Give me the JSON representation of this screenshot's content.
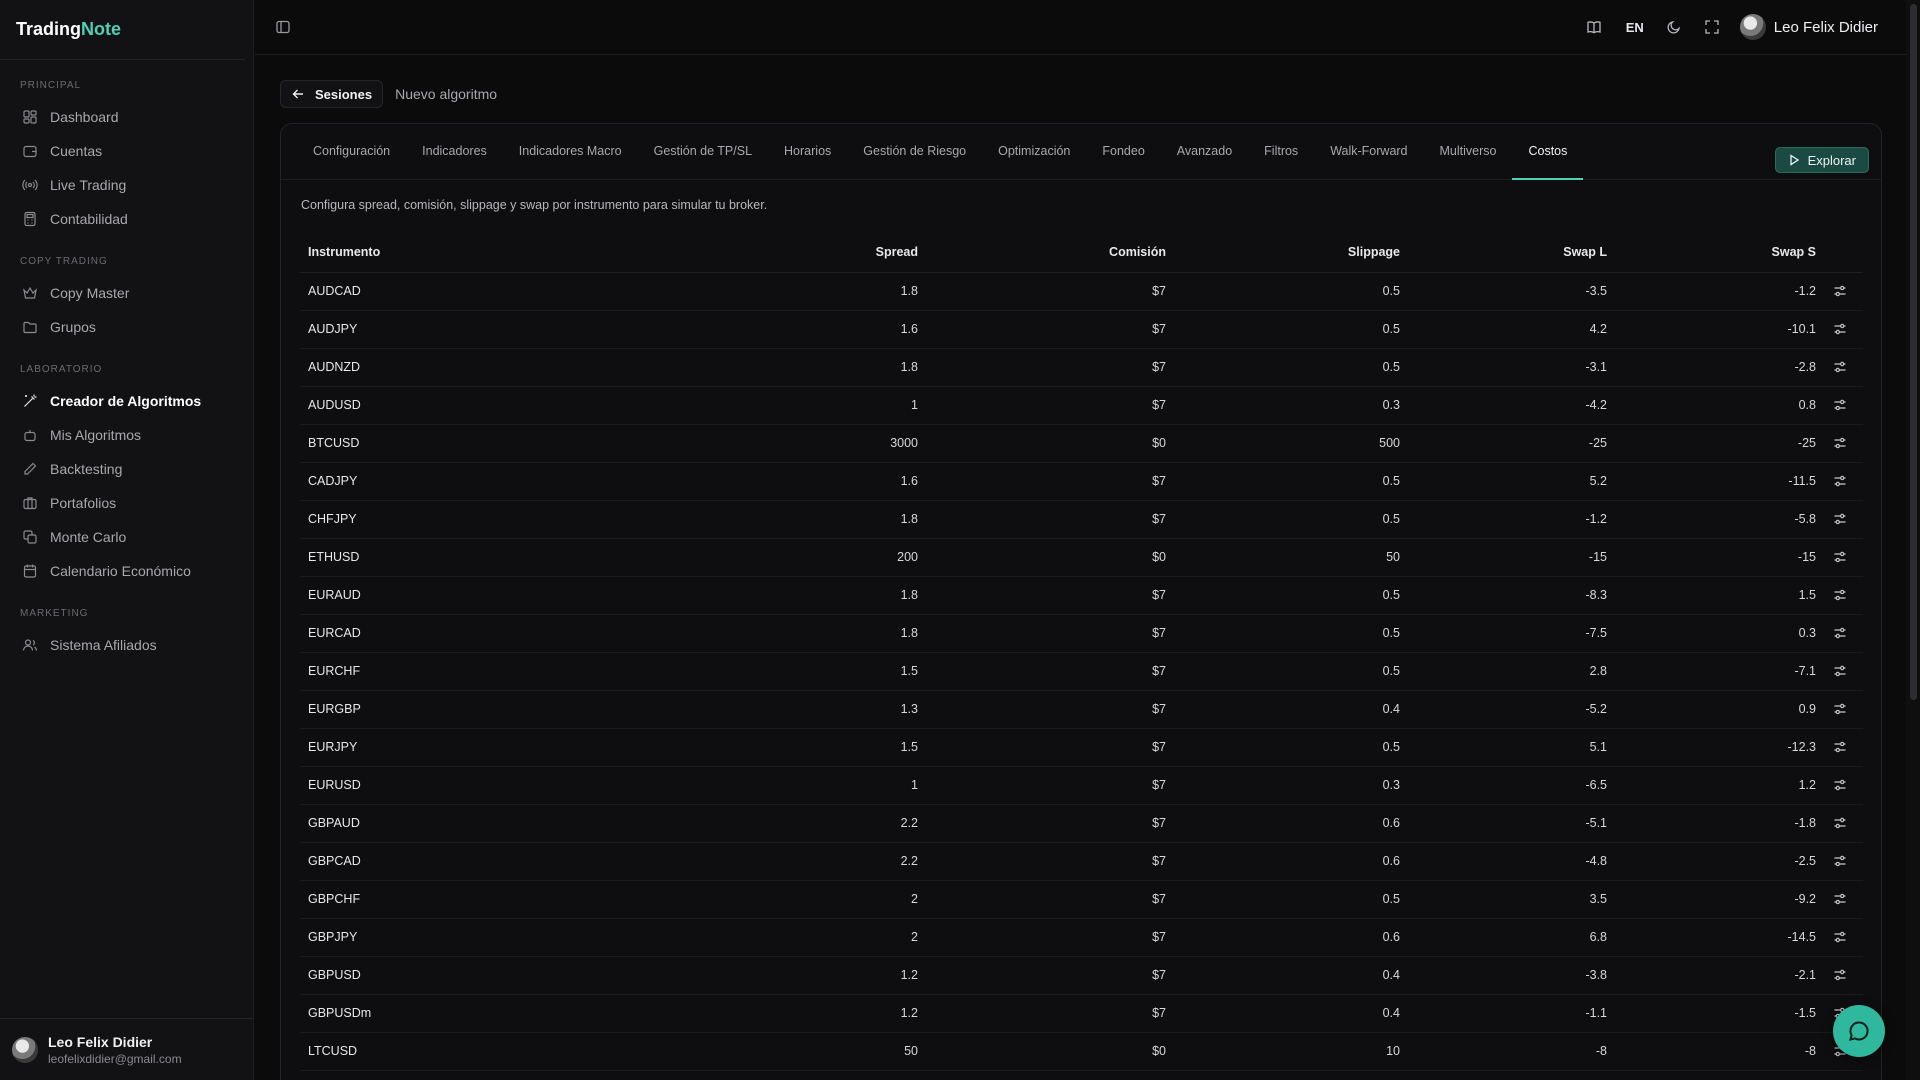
{
  "brand": {
    "part1": "Trading",
    "part2": "Note"
  },
  "sidebar": {
    "sections": [
      {
        "title": "PRINCIPAL",
        "items": [
          {
            "label": "Dashboard",
            "icon": "dashboard-icon"
          },
          {
            "label": "Cuentas",
            "icon": "wallet-icon"
          },
          {
            "label": "Live Trading",
            "icon": "broadcast-icon"
          },
          {
            "label": "Contabilidad",
            "icon": "calculator-icon"
          }
        ]
      },
      {
        "title": "COPY TRADING",
        "items": [
          {
            "label": "Copy Master",
            "icon": "crown-icon"
          },
          {
            "label": "Grupos",
            "icon": "folder-icon"
          }
        ]
      },
      {
        "title": "LABORATORIO",
        "items": [
          {
            "label": "Creador de Algoritmos",
            "icon": "magic-wand-icon",
            "active": true
          },
          {
            "label": "Mis Algoritmos",
            "icon": "robot-icon"
          },
          {
            "label": "Backtesting",
            "icon": "pencil-icon"
          },
          {
            "label": "Portafolios",
            "icon": "briefcase-icon"
          },
          {
            "label": "Monte Carlo",
            "icon": "dice-icon"
          },
          {
            "label": "Calendario Económico",
            "icon": "calendar-icon"
          }
        ]
      },
      {
        "title": "MARKETING",
        "items": [
          {
            "label": "Sistema Afiliados",
            "icon": "users-icon"
          }
        ]
      }
    ]
  },
  "user": {
    "name": "Leo Felix Didier",
    "email": "leofelixdidier@gmail.com"
  },
  "topbar": {
    "lang": "EN"
  },
  "breadcrumb": {
    "back_label": "Sesiones",
    "current": "Nuevo algoritmo"
  },
  "tabs": [
    {
      "label": "Configuración"
    },
    {
      "label": "Indicadores"
    },
    {
      "label": "Indicadores Macro"
    },
    {
      "label": "Gestión de TP/SL"
    },
    {
      "label": "Horarios"
    },
    {
      "label": "Gestión de Riesgo"
    },
    {
      "label": "Optimización"
    },
    {
      "label": "Fondeo"
    },
    {
      "label": "Avanzado"
    },
    {
      "label": "Filtros"
    },
    {
      "label": "Walk-Forward"
    },
    {
      "label": "Multiverso"
    },
    {
      "label": "Costos",
      "active": true
    }
  ],
  "explore_label": "Explorar",
  "description": "Configura spread, comisión, slippage y swap por instrumento para simular tu broker.",
  "table": {
    "headers": [
      "Instrumento",
      "Spread",
      "Comisión",
      "Slippage",
      "Swap L",
      "Swap S"
    ],
    "rows": [
      [
        "AUDCAD",
        "1.8",
        "$7",
        "0.5",
        "-3.5",
        "-1.2"
      ],
      [
        "AUDJPY",
        "1.6",
        "$7",
        "0.5",
        "4.2",
        "-10.1"
      ],
      [
        "AUDNZD",
        "1.8",
        "$7",
        "0.5",
        "-3.1",
        "-2.8"
      ],
      [
        "AUDUSD",
        "1",
        "$7",
        "0.3",
        "-4.2",
        "0.8"
      ],
      [
        "BTCUSD",
        "3000",
        "$0",
        "500",
        "-25",
        "-25"
      ],
      [
        "CADJPY",
        "1.6",
        "$7",
        "0.5",
        "5.2",
        "-11.5"
      ],
      [
        "CHFJPY",
        "1.8",
        "$7",
        "0.5",
        "-1.2",
        "-5.8"
      ],
      [
        "ETHUSD",
        "200",
        "$0",
        "50",
        "-15",
        "-15"
      ],
      [
        "EURAUD",
        "1.8",
        "$7",
        "0.5",
        "-8.3",
        "1.5"
      ],
      [
        "EURCAD",
        "1.8",
        "$7",
        "0.5",
        "-7.5",
        "0.3"
      ],
      [
        "EURCHF",
        "1.5",
        "$7",
        "0.5",
        "2.8",
        "-7.1"
      ],
      [
        "EURGBP",
        "1.3",
        "$7",
        "0.4",
        "-5.2",
        "0.9"
      ],
      [
        "EURJPY",
        "1.5",
        "$7",
        "0.5",
        "5.1",
        "-12.3"
      ],
      [
        "EURUSD",
        "1",
        "$7",
        "0.3",
        "-6.5",
        "1.2"
      ],
      [
        "GBPAUD",
        "2.2",
        "$7",
        "0.6",
        "-5.1",
        "-1.8"
      ],
      [
        "GBPCAD",
        "2.2",
        "$7",
        "0.6",
        "-4.8",
        "-2.5"
      ],
      [
        "GBPCHF",
        "2",
        "$7",
        "0.5",
        "3.5",
        "-9.2"
      ],
      [
        "GBPJPY",
        "2",
        "$7",
        "0.6",
        "6.8",
        "-14.5"
      ],
      [
        "GBPUSD",
        "1.2",
        "$7",
        "0.4",
        "-3.8",
        "-2.1"
      ],
      [
        "GBPUSDm",
        "1.2",
        "$7",
        "0.4",
        "-1.1",
        "-1.5"
      ],
      [
        "LTCUSD",
        "50",
        "$0",
        "10",
        "-8",
        "-8"
      ]
    ]
  },
  "colors": {
    "accent": "#4fd1b7",
    "background": "#0b0b0c",
    "sidebar": "#121214",
    "fab": "#2fb89e"
  }
}
